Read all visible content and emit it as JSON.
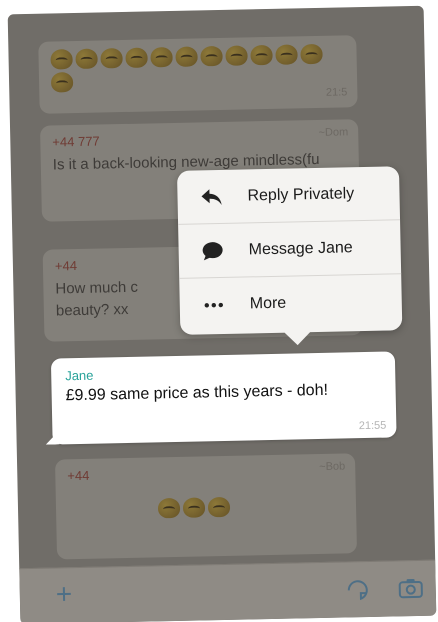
{
  "messages": [
    {
      "sender": "",
      "text": "",
      "time": "21:5"
    },
    {
      "sender": "+44 777",
      "text": "Is it a back-looking new-age mindless(fu",
      "time": "~Dom"
    },
    {
      "sender": "+44",
      "text": "How much c beauty? xx",
      "time": ""
    },
    {
      "sender": "+44",
      "text": "",
      "time": "~Bob"
    }
  ],
  "highlighted": {
    "sender": "Jane",
    "text": "£9.99 same price as this years - doh!",
    "time": "21:55"
  },
  "menu": {
    "items": [
      {
        "label": "Reply Privately",
        "icon": "reply-icon"
      },
      {
        "label": "Message Jane",
        "icon": "chat-bubble-icon"
      },
      {
        "label": "More",
        "icon": "more-dots-icon"
      }
    ]
  },
  "input_bar": {
    "plus": "+",
    "icons": [
      "sticker-icon",
      "camera-icon"
    ]
  },
  "colors": {
    "sender_red": "#8b3d33",
    "jane_teal": "#2aa39a",
    "plus_blue": "#4e6f86"
  }
}
